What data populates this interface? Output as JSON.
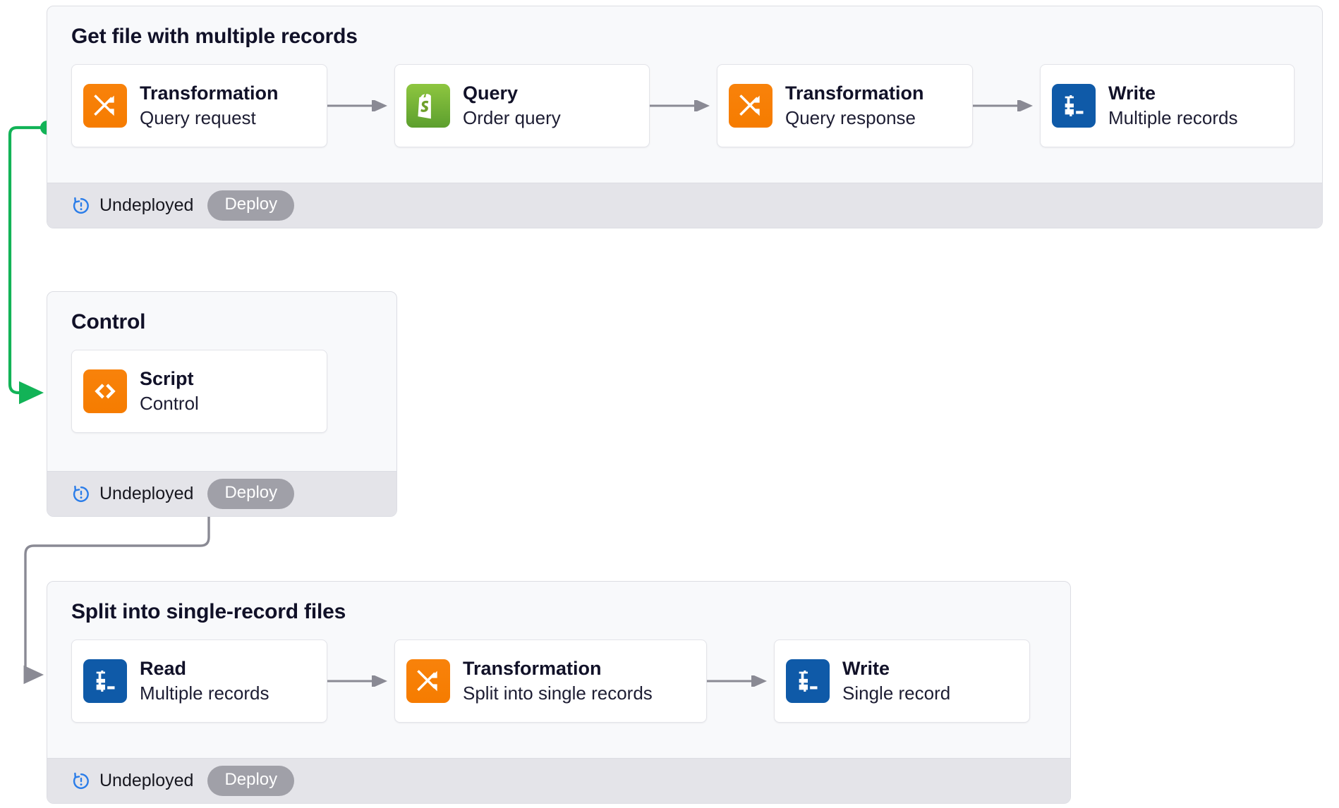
{
  "colors": {
    "canvas_bg": "#ffffff",
    "card_bg": "#f8f9fb",
    "card_border": "#dcdde3",
    "footer_bg": "#e4e4e9",
    "node_bg": "#ffffff",
    "icon_orange": "#f77f00",
    "icon_blue": "#0f5aa8",
    "icon_green": "#76b52f",
    "text_dark": "#111128",
    "connector_gray": "#8a8a94",
    "connector_green": "#12b357",
    "deploy_btn": "#a0a0a8",
    "status_icon_blue": "#2b7de9"
  },
  "flows": [
    {
      "id": "get-file-with-multiple-records",
      "title": "Get file with multiple records",
      "status": {
        "icon": "undeployed-refresh-alert-icon",
        "label": "Undeployed",
        "button_label": "Deploy"
      },
      "nodes": [
        {
          "icon": "transformation-shuffle-icon",
          "icon_color": "orange",
          "title": "Transformation",
          "subtitle": "Query request"
        },
        {
          "icon": "shopify-bag-icon",
          "icon_color": "green",
          "title": "Query",
          "subtitle": "Order query"
        },
        {
          "icon": "transformation-shuffle-icon",
          "icon_color": "orange",
          "title": "Transformation",
          "subtitle": "Query response"
        },
        {
          "icon": "write-terminal-icon",
          "icon_color": "blue",
          "title": "Write",
          "subtitle": "Multiple records"
        }
      ]
    },
    {
      "id": "control",
      "title": "Control",
      "status": {
        "icon": "undeployed-refresh-alert-icon",
        "label": "Undeployed",
        "button_label": "Deploy"
      },
      "nodes": [
        {
          "icon": "script-code-brackets-icon",
          "icon_color": "orange",
          "title": "Script",
          "subtitle": "Control"
        }
      ]
    },
    {
      "id": "split-into-single-record-files",
      "title": "Split into single-record files",
      "status": {
        "icon": "undeployed-refresh-alert-icon",
        "label": "Undeployed",
        "button_label": "Deploy"
      },
      "nodes": [
        {
          "icon": "read-terminal-icon",
          "icon_color": "blue",
          "title": "Read",
          "subtitle": "Multiple records"
        },
        {
          "icon": "transformation-shuffle-icon",
          "icon_color": "orange",
          "title": "Transformation",
          "subtitle": "Split into single records"
        },
        {
          "icon": "write-terminal-icon",
          "icon_color": "blue",
          "title": "Write",
          "subtitle": "Single record"
        }
      ]
    }
  ],
  "connectors": [
    {
      "id": "flow1-to-control",
      "color": "#12b357",
      "from": "get-file-with-multiple-records",
      "to": "control",
      "start_marker": "dot",
      "end_marker": "arrow"
    },
    {
      "id": "control-to-flow3",
      "color": "#8a8a94",
      "from": "control",
      "to": "split-into-single-record-files",
      "start_marker": "dot",
      "end_marker": "arrow"
    }
  ]
}
